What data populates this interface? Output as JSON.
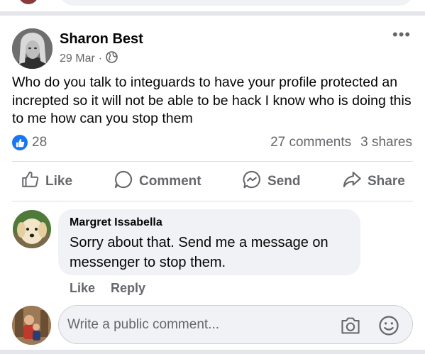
{
  "post": {
    "author": "Sharon Best",
    "date": "29 Mar",
    "separator": "·",
    "privacy_icon": "globe-icon",
    "more_label": "•••",
    "text": "Who do you talk to integuards to have your profile protected an increpted  so it will not be able to be hack I know who is doing this to me how can you stop them",
    "reaction_count": "28",
    "comments_count": "27 comments",
    "shares_count": "3 shares"
  },
  "actions": {
    "like": "Like",
    "comment": "Comment",
    "send": "Send",
    "share": "Share"
  },
  "comment": {
    "author": "Margret Issabella",
    "text": "Sorry about that.  Send me a message on messenger to stop them.",
    "like": "Like",
    "reply": "Reply"
  },
  "composer": {
    "placeholder": "Write a public comment...",
    "camera_icon": "camera-icon",
    "emoji_icon": "emoji-icon"
  },
  "colors": {
    "accent": "#1877f2",
    "secondary_text": "#65676b",
    "bubble": "#f0f2f5"
  }
}
